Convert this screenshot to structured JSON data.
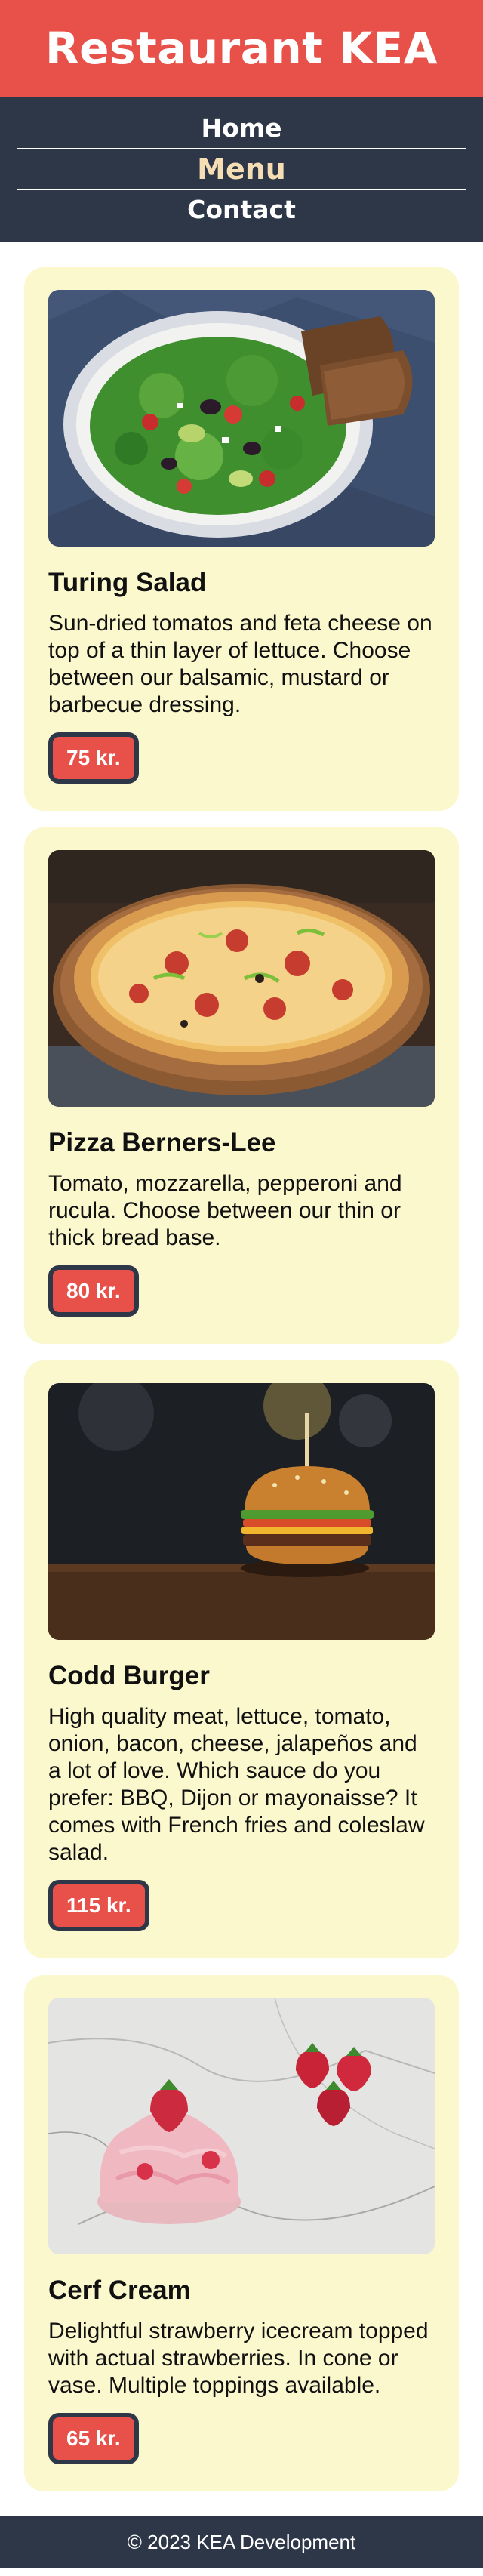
{
  "header": {
    "title": "Restaurant KEA"
  },
  "nav": {
    "items": [
      {
        "label": "Home",
        "active": false
      },
      {
        "label": "Menu",
        "active": true
      },
      {
        "label": "Contact",
        "active": false
      }
    ]
  },
  "menu": [
    {
      "name": "Turing Salad",
      "description": "Sun-dried tomatos and feta cheese on top of a thin layer of lettuce. Choose between our balsamic, mustard or barbecue dressing.",
      "price": "75 kr."
    },
    {
      "name": "Pizza Berners-Lee",
      "description": "Tomato, mozzarella, pepperoni and rucula. Choose between our thin or thick bread base.",
      "price": "80 kr."
    },
    {
      "name": "Codd Burger",
      "description": "High quality meat, lettuce, tomato, onion, bacon, cheese, jalapeños and a lot of love. Which sauce do you prefer: BBQ, Dijon or mayonaisse? It comes with French fries and coleslaw salad.",
      "price": "115 kr."
    },
    {
      "name": "Cerf Cream",
      "description": "Delightful strawberry icecream topped with actual strawberries. In cone or vase. Multiple toppings available.",
      "price": "65 kr."
    }
  ],
  "footer": {
    "text": "© 2023 KEA Development"
  },
  "colors": {
    "brand_red": "#e8514a",
    "navy": "#2d3748",
    "card_bg": "#fbf8cd",
    "active_nav": "#f5deb3"
  }
}
